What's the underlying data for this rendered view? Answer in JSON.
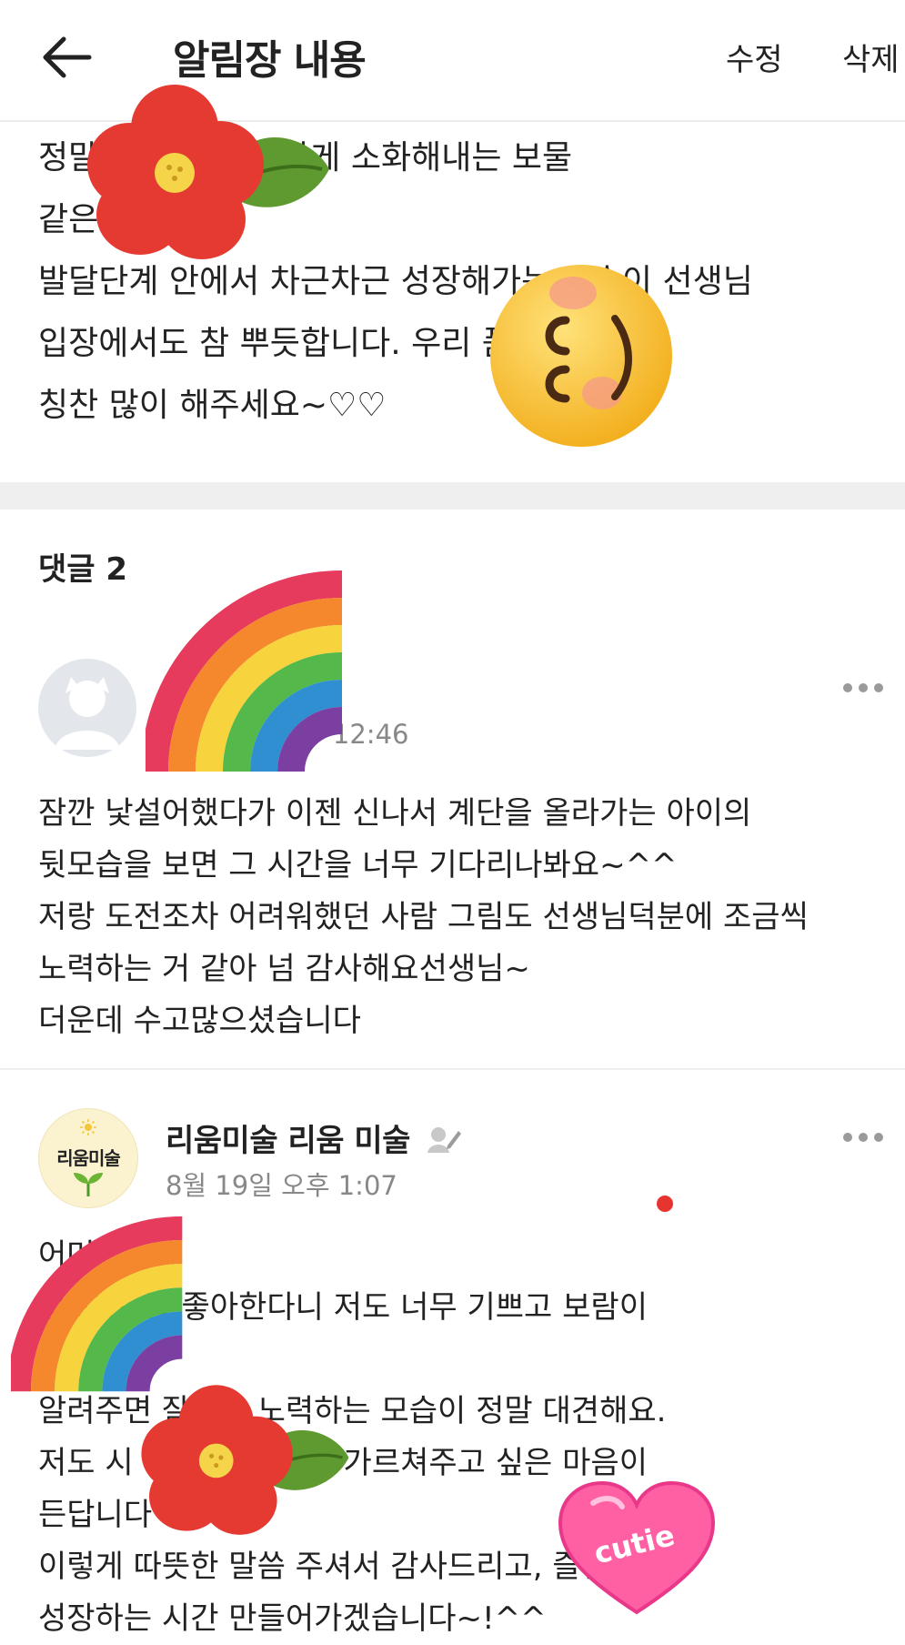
{
  "header": {
    "title": "알림장 내용",
    "edit_label": "수정",
    "delete_label": "삭제"
  },
  "post": {
    "body_lines": [
      "정말 는 것을 성실하게 소화해내는 보물",
      "같은 ♡",
      "발달단계 안에서 차근차근 성장해가는 모습이 선생님",
      "입장에서도 참 뿌듯합니다. 우리 품 보시면서",
      "칭찬 많이 해주세요~♡♡"
    ]
  },
  "comments": {
    "header": "댓글 2",
    "items": [
      {
        "author": "",
        "time": "후 12:46",
        "lines": [
          "잠깐 낯설어했다가 이젠 신나서 계단을 올라가는 아이의",
          "뒷모습을 보면 그 시간을 너무 기다리나봐요~^^",
          "저랑 도전조차 어려워했던 사람 그림도 선생님덕분에 조금씩",
          "노력하는 거 같아 넘 감사해요선생님~",
          "더운데 수고많으셨습니다"
        ]
      },
      {
        "author": "리움미술 리움 미술",
        "avatar_text": "리움미술",
        "time": "8월 19일 오후 1:07",
        "lines": [
          "어머",
          "업 오는 걸  좋아한다니 저도 너무 기쁘고 보람이",
          "♡",
          "알려주면 잘하고  노력하는 모습이 정말 대견해요.",
          "저도 시 덕분에 더 많이 가르쳐주고 싶은 마음이",
          "든답니다",
          "이렇게 따뜻한 말씀 주셔서 감사드리고, 즐겁게",
          "성장하는 시간 만들어가겠습니다~!^^"
        ]
      }
    ]
  },
  "stickers": {
    "heart_text": "cutie"
  },
  "colors": {
    "accent_red": "#e8342f",
    "band": "#efefef",
    "meta_gray": "#888888"
  }
}
